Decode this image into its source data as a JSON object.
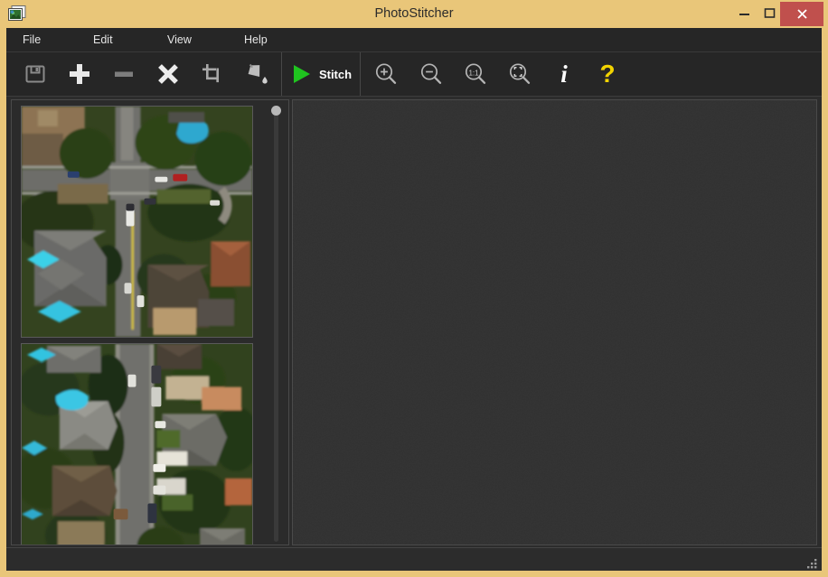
{
  "window": {
    "title": "PhotoStitcher",
    "icon": "stacked-photos-icon",
    "border_color": "#e9c679",
    "controls": {
      "minimize": "–",
      "maximize": "▢",
      "close": "✕",
      "close_color": "#c0504d"
    }
  },
  "menubar": {
    "items": [
      {
        "label": "File"
      },
      {
        "label": "Edit"
      },
      {
        "label": "View"
      },
      {
        "label": "Help"
      }
    ]
  },
  "toolbar": {
    "buttons": [
      {
        "name": "save-button",
        "icon": "floppy-disk-icon",
        "label": "",
        "enabled": false
      },
      {
        "name": "add-image-button",
        "icon": "plus-icon",
        "label": "",
        "enabled": true
      },
      {
        "name": "remove-image-button",
        "icon": "minus-icon",
        "label": "",
        "enabled": false
      },
      {
        "name": "clear-all-button",
        "icon": "cross-icon",
        "label": "",
        "enabled": true
      },
      {
        "name": "crop-button",
        "icon": "crop-icon",
        "label": "",
        "enabled": true
      },
      {
        "name": "fill-button",
        "icon": "paint-bucket-icon",
        "label": "",
        "enabled": true
      },
      {
        "name": "stitch-button",
        "icon": "play-triangle-icon",
        "label": "Stitch",
        "enabled": true
      },
      {
        "name": "zoom-in-button",
        "icon": "magnifier-plus-icon",
        "label": "",
        "enabled": true
      },
      {
        "name": "zoom-out-button",
        "icon": "magnifier-minus-icon",
        "label": "",
        "enabled": true
      },
      {
        "name": "zoom-actual-button",
        "icon": "magnifier-1to1-icon",
        "label": "1:1",
        "enabled": true
      },
      {
        "name": "zoom-fit-button",
        "icon": "magnifier-fit-icon",
        "label": "",
        "enabled": true
      },
      {
        "name": "info-button",
        "icon": "info-i-icon",
        "label": "i",
        "enabled": true
      },
      {
        "name": "help-button",
        "icon": "question-mark-icon",
        "label": "?",
        "enabled": true
      }
    ],
    "stitch_label": "Stitch",
    "stitch_accent": "#1fc41f",
    "help_accent": "#f2d300"
  },
  "left_panel": {
    "thumbnails": [
      {
        "name": "thumbnail-aerial-intersection",
        "alt": "aerial photo of suburban street intersection"
      },
      {
        "name": "thumbnail-aerial-street",
        "alt": "aerial photo of suburban residential street"
      }
    ],
    "scrollbar": {
      "name": "thumbnail-scrollbar",
      "position": "top"
    }
  },
  "canvas": {
    "name": "stitch-preview-canvas",
    "content": "",
    "background": "#313131"
  },
  "statusbar": {
    "text": "",
    "resize_grip": "resize-grip-icon"
  }
}
